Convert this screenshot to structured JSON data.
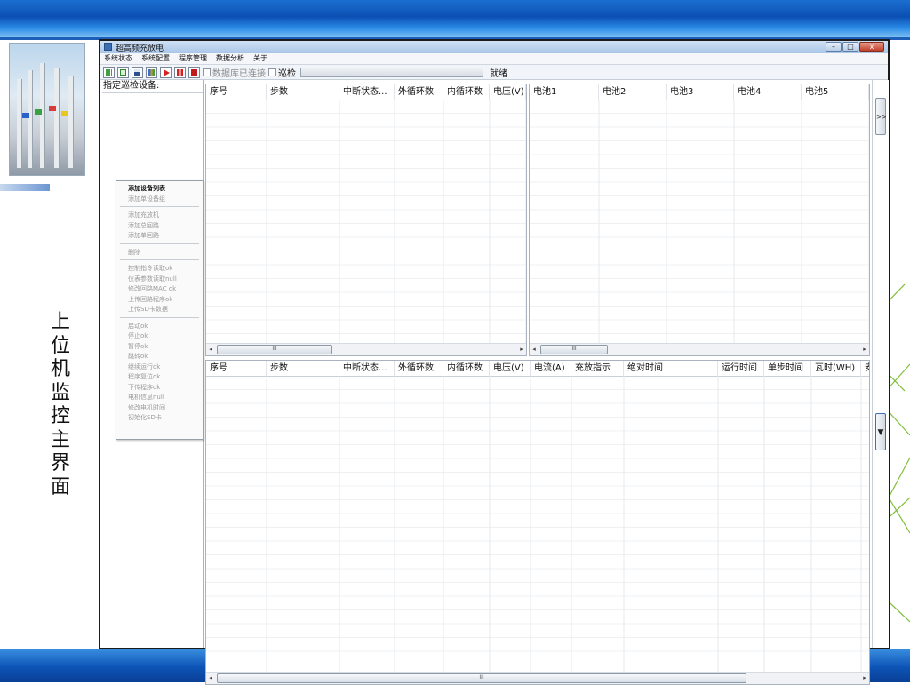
{
  "slide": {
    "caption": "上位机监控主界面",
    "colors": {
      "top_bar": "#0c4fb3",
      "bottom_bar": "#0d54b6",
      "deco_lines": "#7fbf3a"
    }
  },
  "window": {
    "title": "超高频充放电",
    "controls": {
      "minimize": "–",
      "maximize": "□",
      "close": "x"
    },
    "menu": [
      "系统状态",
      "系统配置",
      "程序管理",
      "数据分析",
      "关于"
    ],
    "toolbar": {
      "buttons": [
        {
          "name": "grid-icon",
          "color": "#3ea03e"
        },
        {
          "name": "select-icon",
          "color": "#2f8a2f"
        },
        {
          "name": "save-icon",
          "color": "#2d4f8f"
        },
        {
          "name": "chart-icon",
          "color": "#d98f1e"
        },
        {
          "name": "play-icon",
          "color": "#d32222"
        },
        {
          "name": "pause-icon",
          "color": "#d32222"
        },
        {
          "name": "stop-icon",
          "color": "#c21a1a"
        }
      ],
      "db_checkbox_label": "数据库已连接",
      "patrol_checkbox_label": "巡检",
      "progress_fraction": 0,
      "status": "就绪"
    },
    "left_panel": {
      "title": "指定巡检设备:",
      "context_menu": {
        "groups": [
          [
            "添加设备列表",
            "添加单设备组"
          ],
          [
            "添加充放机",
            "添加总回路",
            "添加单回路"
          ],
          [
            "删除"
          ],
          [
            "控制指令读取ok",
            "仪表参数读取null",
            "修改回路MAC ok",
            "上传回路程序ok",
            "上传SD卡数据"
          ],
          [
            "启动ok",
            "停止ok",
            "暂停ok",
            "跳转ok",
            "继续运行ok",
            "程序复位ok",
            "下传程序ok",
            "电机信息null",
            "修改电机时间",
            "初始化SD卡"
          ]
        ]
      }
    },
    "grid_top_left": {
      "columns": [
        "序号",
        "步数",
        "中断状态...",
        "外循环数",
        "内循环数",
        "电压(V)"
      ]
    },
    "grid_top_right": {
      "columns": [
        "电池1",
        "电池2",
        "电池3",
        "电池4",
        "电池5"
      ]
    },
    "grid_bottom": {
      "columns": [
        "序号",
        "步数",
        "中断状态...",
        "外循环数",
        "内循环数",
        "电压(V)",
        "电流(A)",
        "充放指示",
        "绝对时间",
        "运行时间",
        "单步时间",
        "瓦时(WH)",
        "安"
      ]
    },
    "expand_button": ">>",
    "dropdown_button": "▼",
    "scroll_grip": "III"
  }
}
